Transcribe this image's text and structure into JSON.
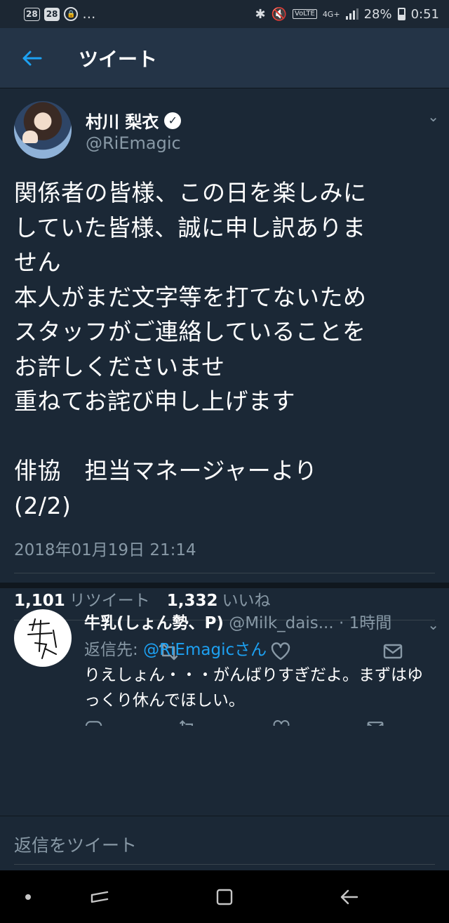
{
  "status_bar": {
    "left_items": [
      "28",
      "28",
      "…"
    ],
    "network": "4G+",
    "volte": "VoLTE",
    "battery": "28%",
    "time": "0:51"
  },
  "header": {
    "title": "ツイート"
  },
  "tweet": {
    "author_name": "村川 梨衣",
    "handle": "@RiEmagic",
    "text": "関係者の皆様、この日を楽しみに\nしていた皆様、誠に申し訳ありま\nせん\n本人がまだ文字等を打てないため\nスタッフがご連絡していることを\nお許しくださいませ\n重ねてお詫び申し上げます\n\n俳協　担当マネージャーより\n(2/2)",
    "timestamp": "2018年01月19日 21:14",
    "retweet_count": "1,101",
    "retweet_label": "リツイート",
    "like_count": "1,332",
    "like_label": "いいね"
  },
  "reply": {
    "author_name": "牛乳(しょん勢、P)",
    "handle": "@Milk_dais...",
    "time": "· 1時間",
    "reply_to_label": "返信先:",
    "reply_to_mention": "@RiEmagicさん",
    "text": "りえしょん・・・がんばりすぎだよ。まずはゆっくり休んでほしい。"
  },
  "compose": {
    "placeholder": "返信をツイート"
  },
  "colors": {
    "background": "#1b2836",
    "header": "#243447",
    "accent": "#1da1f2",
    "muted": "#8899a6"
  },
  "icons": [
    "back-arrow-icon",
    "verified-icon",
    "chevron-down-icon",
    "reply-icon",
    "retweet-icon",
    "like-icon",
    "message-icon",
    "nav-dot-icon",
    "nav-recents-icon",
    "nav-home-icon",
    "nav-back-icon"
  ]
}
